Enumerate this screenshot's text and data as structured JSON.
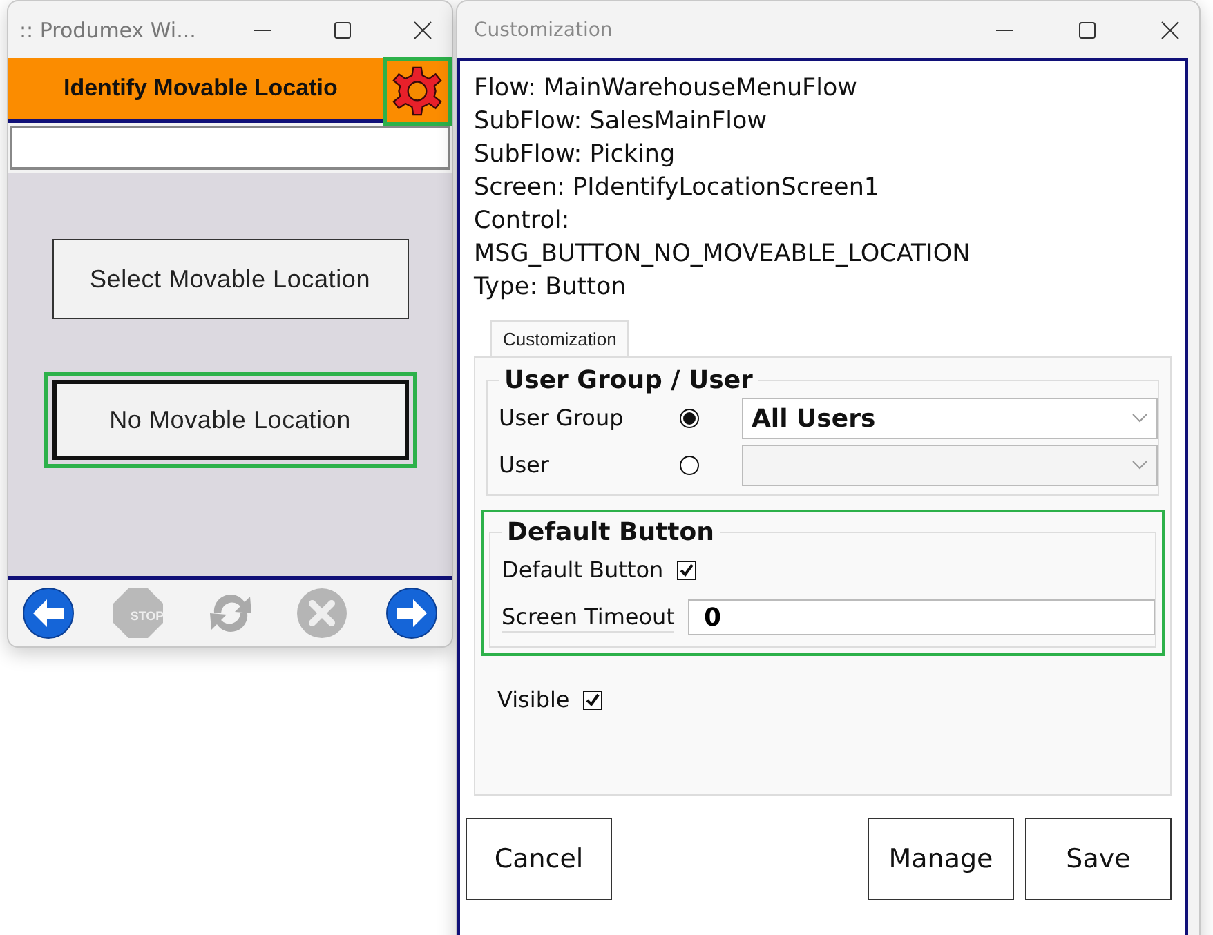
{
  "left_window": {
    "title": ":: Produmex Wi...",
    "header": "Identify Movable Locatio",
    "gear_highlighted": true,
    "buttons": [
      {
        "label": "Select Movable Location",
        "highlighted": false
      },
      {
        "label": "No Movable Location",
        "highlighted": true
      }
    ],
    "toolbar": [
      {
        "kind": "back",
        "disabled": false
      },
      {
        "kind": "stop",
        "disabled": true,
        "label": "STOP"
      },
      {
        "kind": "refresh",
        "disabled": true
      },
      {
        "kind": "cancel",
        "disabled": true
      },
      {
        "kind": "forward",
        "disabled": false
      }
    ]
  },
  "right_window": {
    "title": "Customization",
    "info_lines": [
      "Flow: MainWarehouseMenuFlow",
      "SubFlow: SalesMainFlow",
      "SubFlow: Picking",
      "Screen: PIdentifyLocationScreen1",
      "Control:",
      "MSG_BUTTON_NO_MOVEABLE_LOCATION",
      "Type: Button"
    ],
    "tabs": [
      {
        "label": "Customization",
        "selected": true
      }
    ],
    "user_group": {
      "title": "User Group / User",
      "rows": [
        {
          "label": "User Group",
          "selected": true,
          "value": "All Users"
        },
        {
          "label": "User",
          "selected": false
        }
      ]
    },
    "default_button": {
      "title": "Default Button",
      "highlighted": true,
      "checkbox": {
        "label": "Default Button",
        "checked": true
      },
      "timeout": {
        "label": "Screen Timeout",
        "value": "0"
      }
    },
    "visible": {
      "label": "Visible",
      "checked": true
    },
    "buttons": [
      "Cancel",
      "Manage",
      "Save"
    ]
  }
}
